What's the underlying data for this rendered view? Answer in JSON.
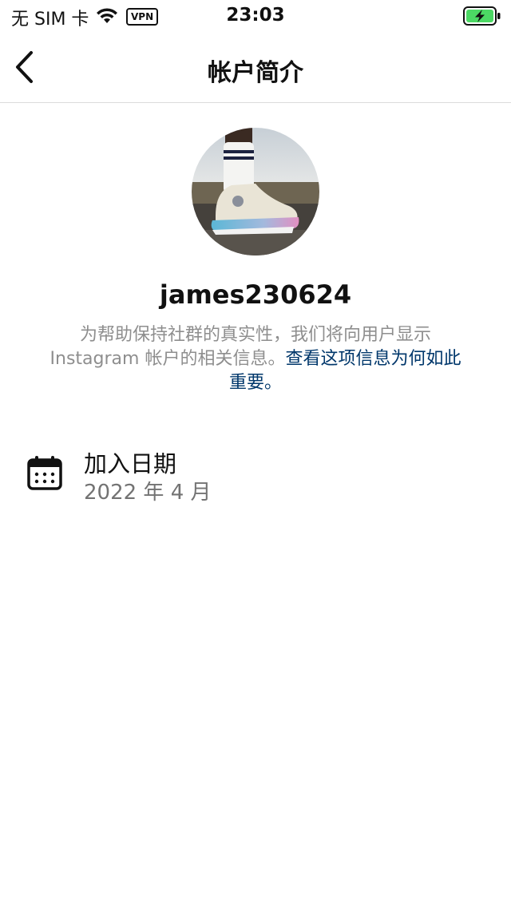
{
  "status_bar": {
    "carrier": "无 SIM 卡",
    "vpn": "VPN",
    "time": "23:03"
  },
  "nav": {
    "title": "帐户简介"
  },
  "profile": {
    "username": "james230624",
    "info_text": "为帮助保持社群的真实性，我们将向用户显示 Instagram 帐户的相关信息。",
    "info_link": "查看这项信息为何如此重要。"
  },
  "joined": {
    "label": "加入日期",
    "value": "2022 年 4 月"
  },
  "colors": {
    "link": "#00376b",
    "secondary_text": "#8e8e8e",
    "battery_green": "#4cd964",
    "divider": "#dbdbdb"
  },
  "icons": {
    "back": "chevron-left-icon",
    "calendar": "calendar-icon",
    "wifi": "wifi-icon",
    "battery": "battery-charging-icon"
  }
}
